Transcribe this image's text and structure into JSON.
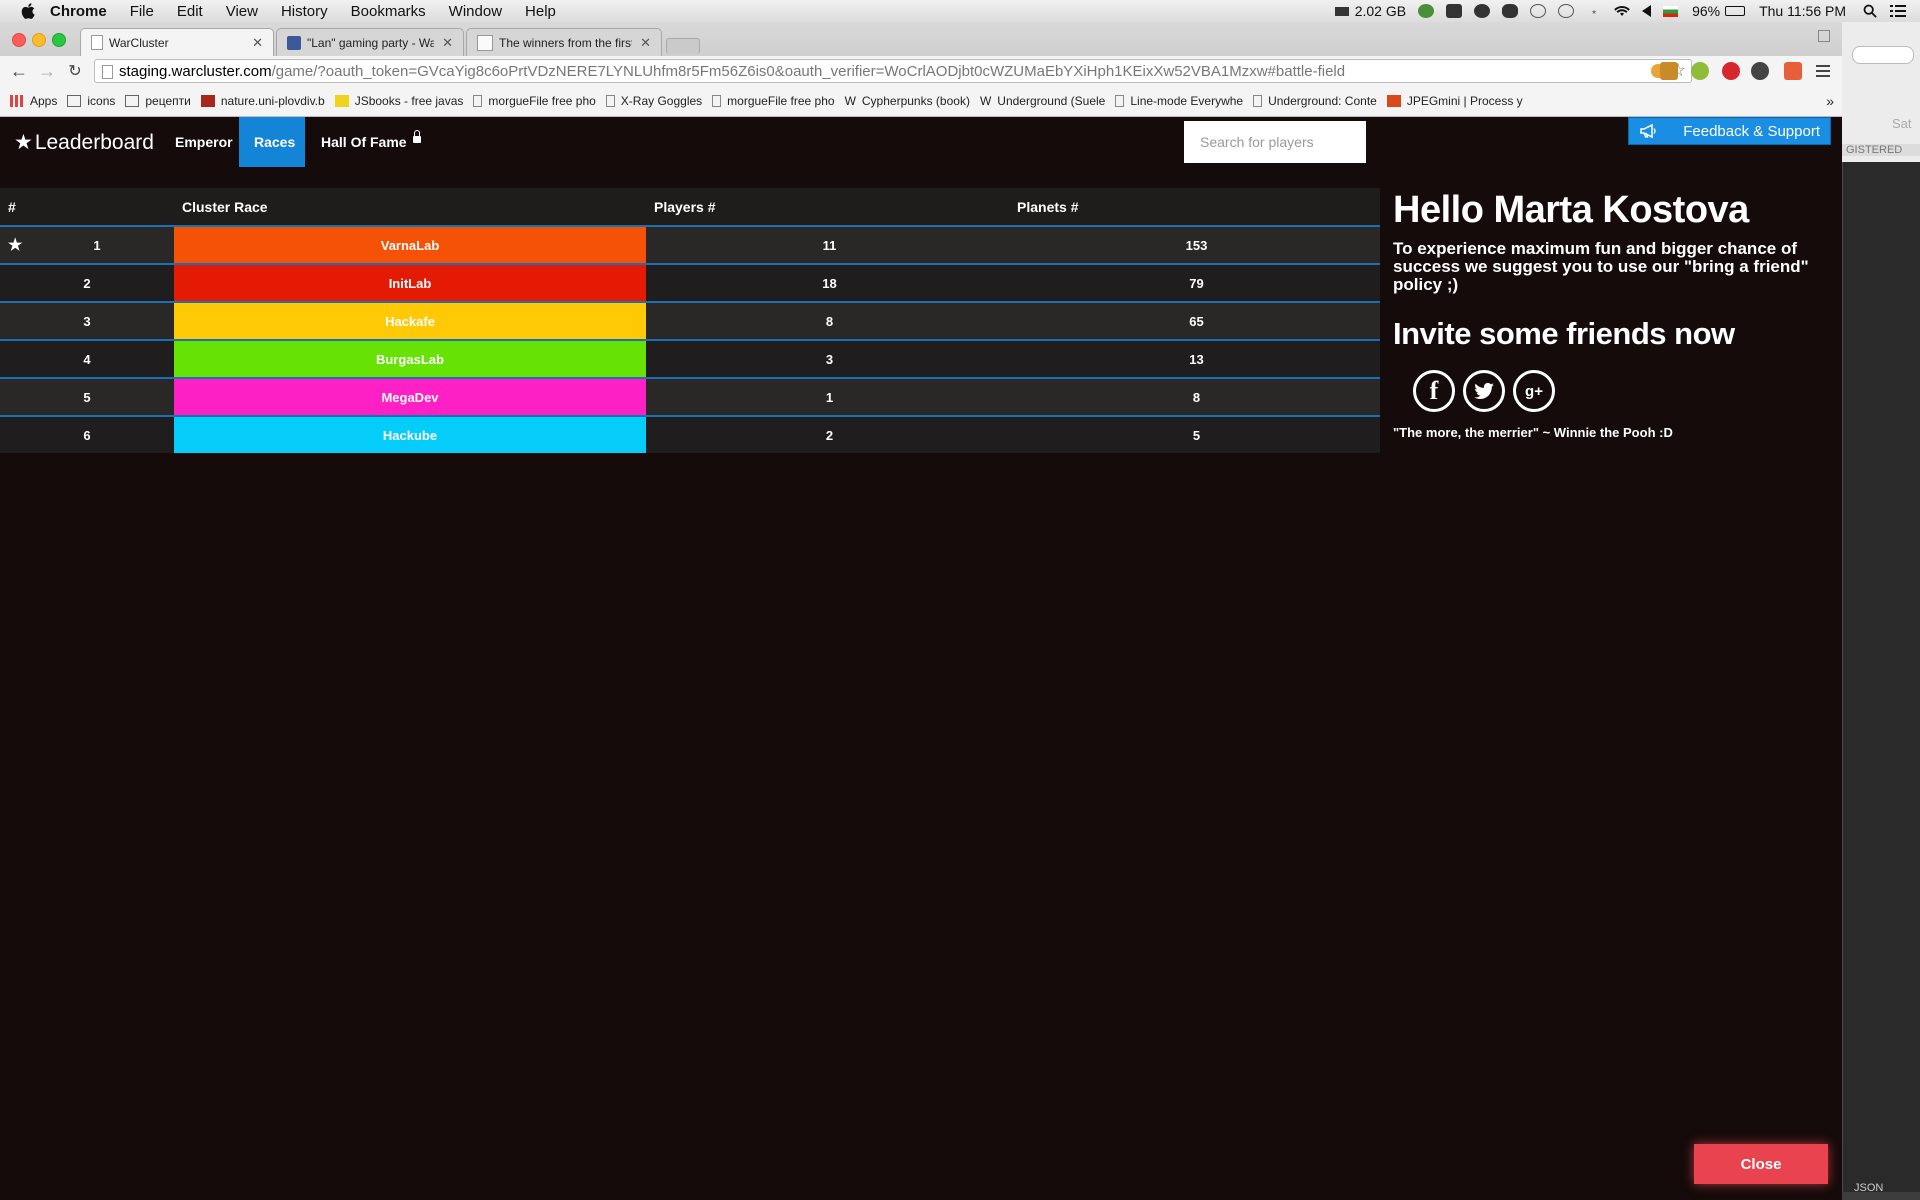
{
  "menubar": {
    "app": "Chrome",
    "items": [
      "File",
      "Edit",
      "View",
      "History",
      "Bookmarks",
      "Window",
      "Help"
    ],
    "memory": "2.02 GB",
    "battery": "96%",
    "clock": "Thu 11:56 PM"
  },
  "browser": {
    "tabs": [
      {
        "title": "WarCluster",
        "active": true
      },
      {
        "title": "\"Lan\" gaming party - WarC",
        "active": false
      },
      {
        "title": "The winners from the first",
        "active": false
      }
    ],
    "url_host": "staging.warcluster.com",
    "url_path": "/game/?oauth_token=GVcaYig8c6oPrtVDzNERE7LYNLUhfm8r5Fm56Z6is0&oauth_verifier=WoCrlAODjbt0cWZUMaEbYXiHph1KEixXw52VBA1Mzxw#battle-field",
    "bookmarks": [
      "Apps",
      "icons",
      "рецепти",
      "nature.uni-plovdiv.b",
      "JSbooks - free javas",
      "morgueFile free pho",
      "X-Ray Goggles",
      "morgueFile free pho",
      "Cypherpunks (book)",
      "Underground (Suele",
      "Line-mode Everywhe",
      "Underground: Conte",
      "JPEGmini | Process y"
    ],
    "bookmarks_more": "»"
  },
  "nav": {
    "brand": "Leaderboard",
    "brand_icon": "star-icon",
    "links": [
      "Emperor",
      "Races",
      "Hall Of Fame"
    ],
    "active_link": "Races",
    "search_placeholder": "Search for players",
    "feedback_label": "Feedback & Support"
  },
  "table": {
    "headers": [
      "#",
      "Cluster Race",
      "Players #",
      "Planets #"
    ],
    "rows": [
      {
        "rank": "1",
        "race": "VarnaLab",
        "color": "#f55208",
        "players": "11",
        "planets": "153"
      },
      {
        "rank": "2",
        "race": "InitLab",
        "color": "#e41a05",
        "players": "18",
        "planets": "79"
      },
      {
        "rank": "3",
        "race": "Hackafe",
        "color": "#ffc905",
        "players": "8",
        "planets": "65"
      },
      {
        "rank": "4",
        "race": "BurgasLab",
        "color": "#66e305",
        "players": "3",
        "planets": "13"
      },
      {
        "rank": "5",
        "race": "MegaDev",
        "color": "#fd21c5",
        "players": "1",
        "planets": "8"
      },
      {
        "rank": "6",
        "race": "Hackube",
        "color": "#05cdfa",
        "players": "2",
        "planets": "5"
      }
    ]
  },
  "panel": {
    "greeting": "Hello Marta Kostova",
    "message": "To experience maximum fun and bigger chance of success we suggest you to use our \"bring a friend\" policy ;)",
    "invite": "Invite some friends now",
    "social": [
      "facebook-icon",
      "twitter-icon",
      "google-plus-icon"
    ],
    "quote": "\"The more, the merrier\" ~ Winnie the Pooh :D"
  },
  "close_label": "Close",
  "dock": {
    "sat": "Sat",
    "registered": "GISTERED",
    "json": "JSON"
  }
}
